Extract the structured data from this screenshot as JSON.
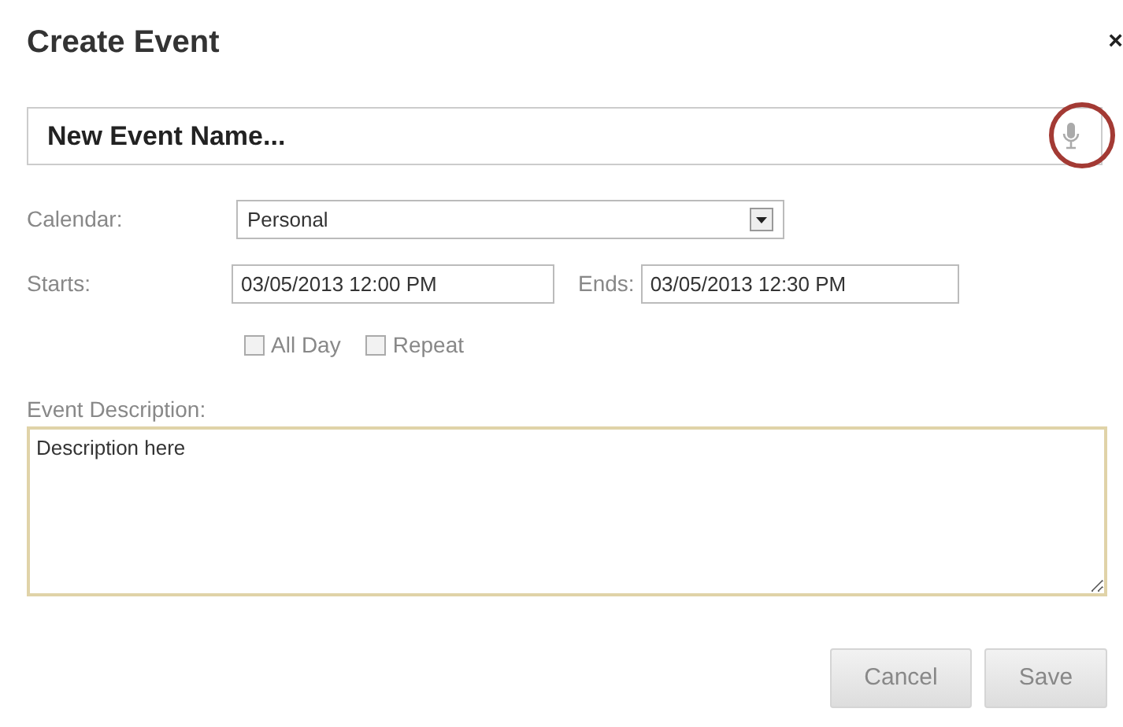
{
  "dialog": {
    "title": "Create Event",
    "close": "×"
  },
  "name_field": {
    "value": "New Event Name...",
    "mic_highlighted": true
  },
  "calendar": {
    "label": "Calendar:",
    "value": "Personal"
  },
  "starts": {
    "label": "Starts:",
    "value": "03/05/2013 12:00 PM"
  },
  "ends": {
    "label": "Ends:",
    "value": "03/05/2013 12:30 PM"
  },
  "options": [
    {
      "label": "All Day",
      "checked": false
    },
    {
      "label": "Repeat",
      "checked": false
    }
  ],
  "description": {
    "label": "Event Description:",
    "value": "Description here"
  },
  "buttons": [
    {
      "label": "Cancel"
    },
    {
      "label": "Save"
    }
  ]
}
